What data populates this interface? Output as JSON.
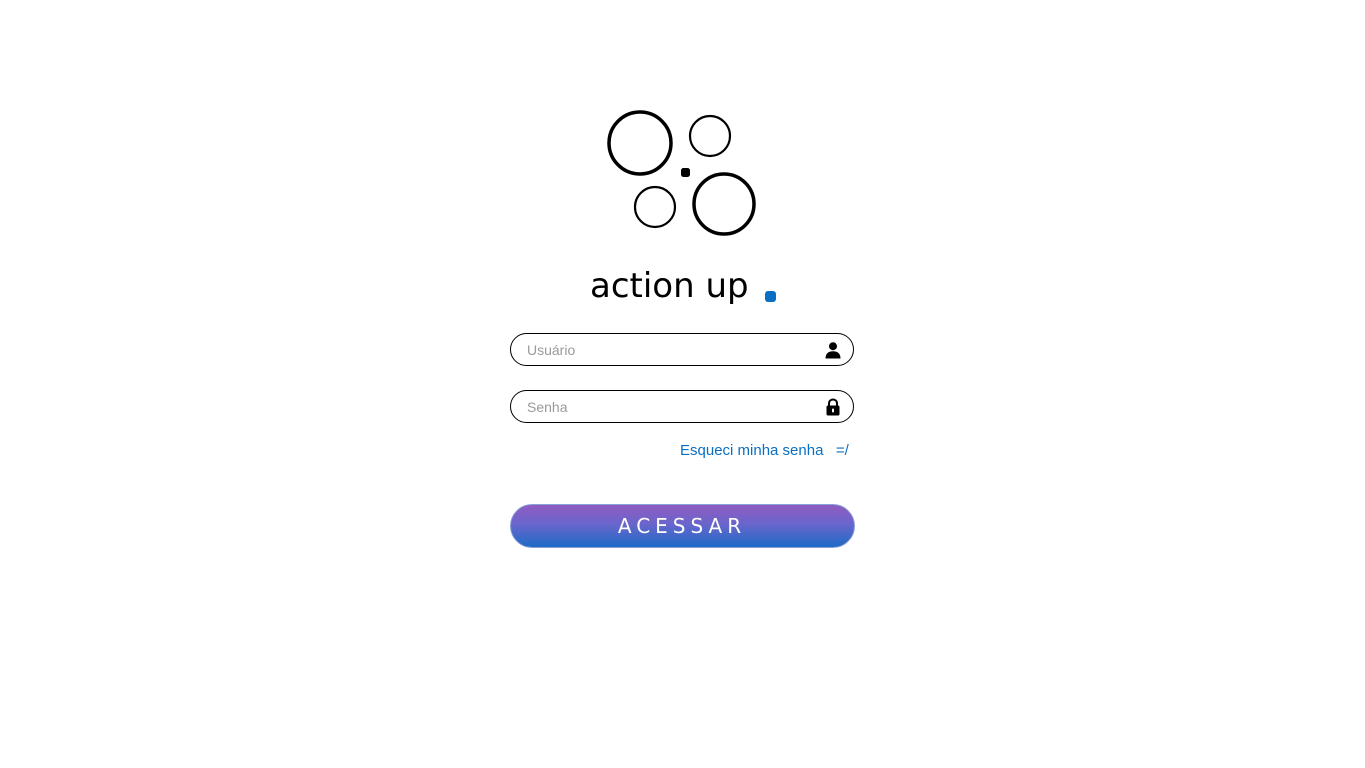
{
  "brand": {
    "name": "action up",
    "accent_color": "#0a6fc2"
  },
  "login": {
    "username_placeholder": "Usuário",
    "password_placeholder": "Senha",
    "username_icon": "user-icon",
    "password_icon": "lock-icon",
    "forgot_password_label": "Esqueci minha senha   =/",
    "link_color": "#0a6fc2",
    "submit_label": "ACESSAR"
  }
}
